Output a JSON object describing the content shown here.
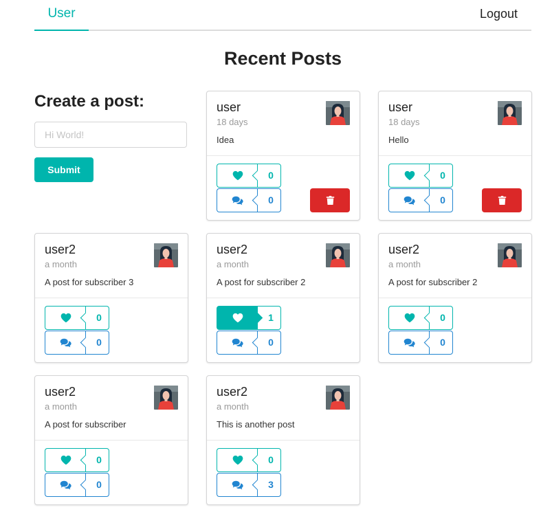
{
  "nav": {
    "user_tab": "User",
    "logout": "Logout"
  },
  "page_title": "Recent Posts",
  "create": {
    "title": "Create a post:",
    "placeholder": "Hi World!",
    "submit_label": "Submit"
  },
  "colors": {
    "teal": "#00b5ad",
    "blue": "#2185d0",
    "red": "#db2828"
  },
  "icons": {
    "like": "heart-icon",
    "comment": "comments-icon",
    "delete": "trash-icon"
  },
  "posts": [
    {
      "author": "user",
      "time": "18 days",
      "text": "Idea",
      "likes": "0",
      "comments": "0",
      "liked": false,
      "deletable": true
    },
    {
      "author": "user",
      "time": "18 days",
      "text": "Hello",
      "likes": "0",
      "comments": "0",
      "liked": false,
      "deletable": true
    },
    {
      "author": "user2",
      "time": "a month",
      "text": "A post for subscriber 3",
      "likes": "0",
      "comments": "0",
      "liked": false,
      "deletable": false
    },
    {
      "author": "user2",
      "time": "a month",
      "text": "A post for subscriber 2",
      "likes": "1",
      "comments": "0",
      "liked": true,
      "deletable": false
    },
    {
      "author": "user2",
      "time": "a month",
      "text": "A post for subscriber 2",
      "likes": "0",
      "comments": "0",
      "liked": false,
      "deletable": false
    },
    {
      "author": "user2",
      "time": "a month",
      "text": "A post for subscriber",
      "likes": "0",
      "comments": "0",
      "liked": false,
      "deletable": false
    },
    {
      "author": "user2",
      "time": "a month",
      "text": "This is another post",
      "likes": "0",
      "comments": "3",
      "liked": false,
      "deletable": false
    }
  ]
}
